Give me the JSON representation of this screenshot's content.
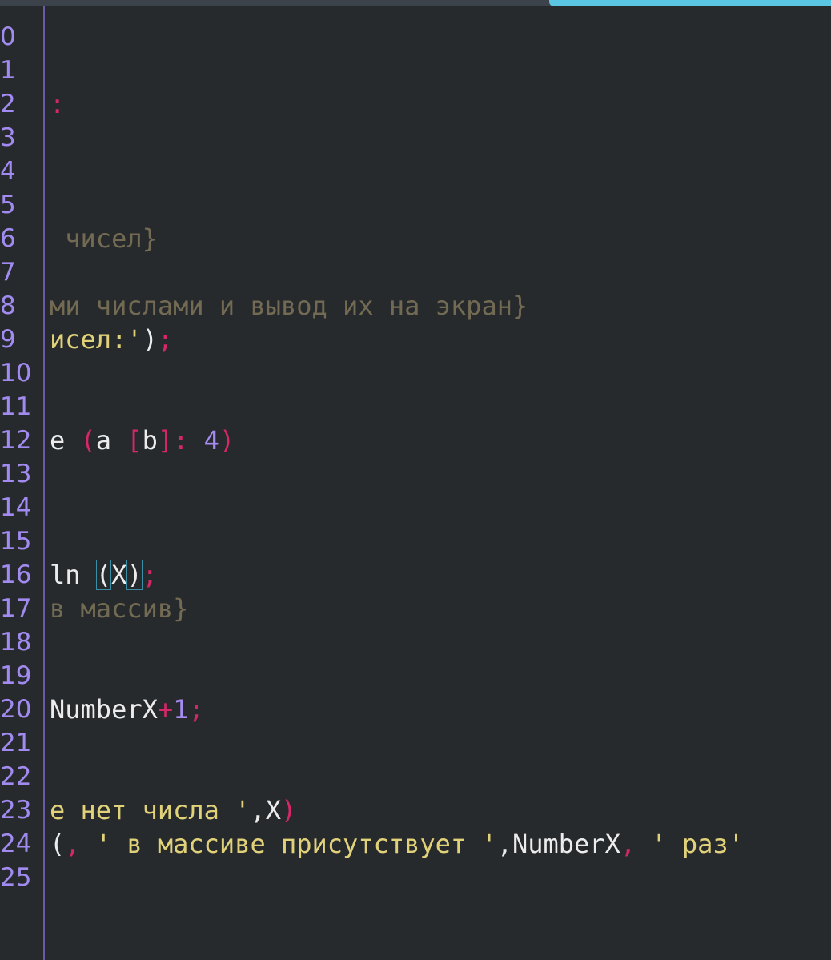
{
  "editor": {
    "scrollbar_thumb_color": "#5bc6e4",
    "gutter_color": "#a28bf0",
    "lines": [
      {
        "num": "0",
        "tokens": []
      },
      {
        "num": "1",
        "tokens": []
      },
      {
        "num": "2",
        "tokens": [
          {
            "text": ":",
            "cls": "c-partial"
          }
        ]
      },
      {
        "num": "3",
        "tokens": []
      },
      {
        "num": "4",
        "tokens": []
      },
      {
        "num": "5",
        "tokens": []
      },
      {
        "num": "6",
        "tokens": [
          {
            "text": " чисел}",
            "cls": "c-comment"
          }
        ]
      },
      {
        "num": "7",
        "tokens": []
      },
      {
        "num": "8",
        "tokens": [
          {
            "text": "ми числами и вывод их на экран}",
            "cls": "c-comment"
          }
        ]
      },
      {
        "num": "9",
        "tokens": [
          {
            "text": "исел:'",
            "cls": "c-string"
          },
          {
            "text": ")",
            "cls": "c-plain"
          },
          {
            "text": ";",
            "cls": "c-punct"
          }
        ]
      },
      {
        "num": "10",
        "tokens": []
      },
      {
        "num": "11",
        "tokens": []
      },
      {
        "num": "12",
        "tokens": [
          {
            "text": "е ",
            "cls": "c-plain"
          },
          {
            "text": "(",
            "cls": "c-punct"
          },
          {
            "text": "a ",
            "cls": "c-plain"
          },
          {
            "text": "[",
            "cls": "c-punct"
          },
          {
            "text": "b",
            "cls": "c-plain"
          },
          {
            "text": "]: ",
            "cls": "c-punct"
          },
          {
            "text": "4",
            "cls": "c-num"
          },
          {
            "text": ")",
            "cls": "c-punct"
          }
        ]
      },
      {
        "num": "13",
        "tokens": []
      },
      {
        "num": "14",
        "tokens": []
      },
      {
        "num": "15",
        "tokens": []
      },
      {
        "num": "16",
        "tokens": [
          {
            "text": "ln ",
            "cls": "c-plain"
          },
          {
            "text": "(",
            "cls": "c-plain",
            "box": true
          },
          {
            "text": "X",
            "cls": "c-plain"
          },
          {
            "text": ")",
            "cls": "c-plain",
            "box": true
          },
          {
            "text": ";",
            "cls": "c-punct"
          }
        ]
      },
      {
        "num": "17",
        "tokens": [
          {
            "text": "в массив}",
            "cls": "c-comment"
          }
        ]
      },
      {
        "num": "18",
        "tokens": []
      },
      {
        "num": "19",
        "tokens": []
      },
      {
        "num": "20",
        "tokens": [
          {
            "text": "NumberX",
            "cls": "c-plain"
          },
          {
            "text": "+",
            "cls": "c-op"
          },
          {
            "text": "1",
            "cls": "c-num"
          },
          {
            "text": ";",
            "cls": "c-punct"
          }
        ]
      },
      {
        "num": "21",
        "tokens": []
      },
      {
        "num": "22",
        "tokens": []
      },
      {
        "num": "23",
        "tokens": [
          {
            "text": "е нет числа '",
            "cls": "c-string"
          },
          {
            "text": ",X",
            "cls": "c-plain"
          },
          {
            "text": ")",
            "cls": "c-punct"
          }
        ]
      },
      {
        "num": "24",
        "tokens": [
          {
            "text": "(",
            "cls": "c-plain"
          },
          {
            "text": ", ",
            "cls": "c-punct"
          },
          {
            "text": "' в массиве присутствует '",
            "cls": "c-string"
          },
          {
            "text": ",NumberX",
            "cls": "c-plain"
          },
          {
            "text": ", ",
            "cls": "c-punct"
          },
          {
            "text": "' раз'",
            "cls": "c-string"
          }
        ]
      },
      {
        "num": "25",
        "tokens": []
      }
    ]
  }
}
